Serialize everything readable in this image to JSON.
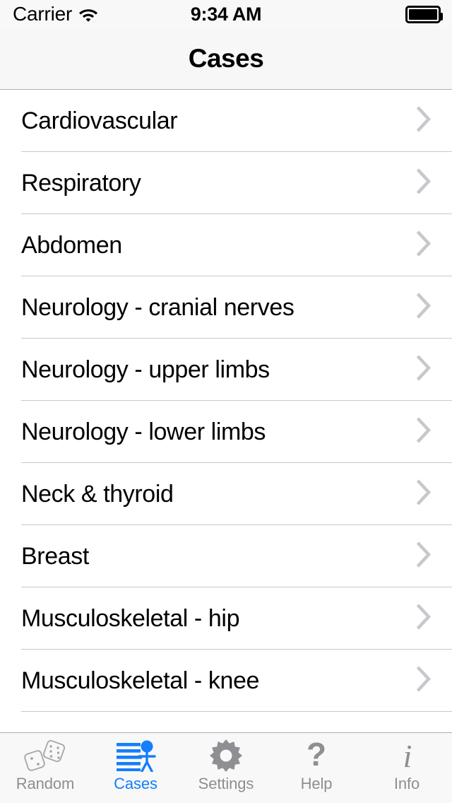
{
  "status_bar": {
    "carrier": "Carrier",
    "wifi_icon": "wifi-icon",
    "time": "9:34 AM",
    "battery_icon": "battery-full-icon"
  },
  "nav_bar": {
    "title": "Cases"
  },
  "list": {
    "disclosure_icon": "chevron-right-icon",
    "rows": [
      {
        "label": "Cardiovascular"
      },
      {
        "label": "Respiratory"
      },
      {
        "label": "Abdomen"
      },
      {
        "label": "Neurology - cranial nerves"
      },
      {
        "label": "Neurology - upper limbs"
      },
      {
        "label": "Neurology - lower limbs"
      },
      {
        "label": "Neck & thyroid"
      },
      {
        "label": "Breast"
      },
      {
        "label": "Musculoskeletal - hip"
      },
      {
        "label": "Musculoskeletal - knee"
      }
    ]
  },
  "tab_bar": {
    "active_color": "#147efb",
    "inactive_color": "#8e8e93",
    "items": [
      {
        "label": "Random",
        "icon": "dice-icon",
        "active": false
      },
      {
        "label": "Cases",
        "icon": "cases-icon",
        "active": true
      },
      {
        "label": "Settings",
        "icon": "gear-icon",
        "active": false
      },
      {
        "label": "Help",
        "icon": "question-mark-icon",
        "active": false
      },
      {
        "label": "Info",
        "icon": "info-i-icon",
        "active": false
      }
    ]
  }
}
